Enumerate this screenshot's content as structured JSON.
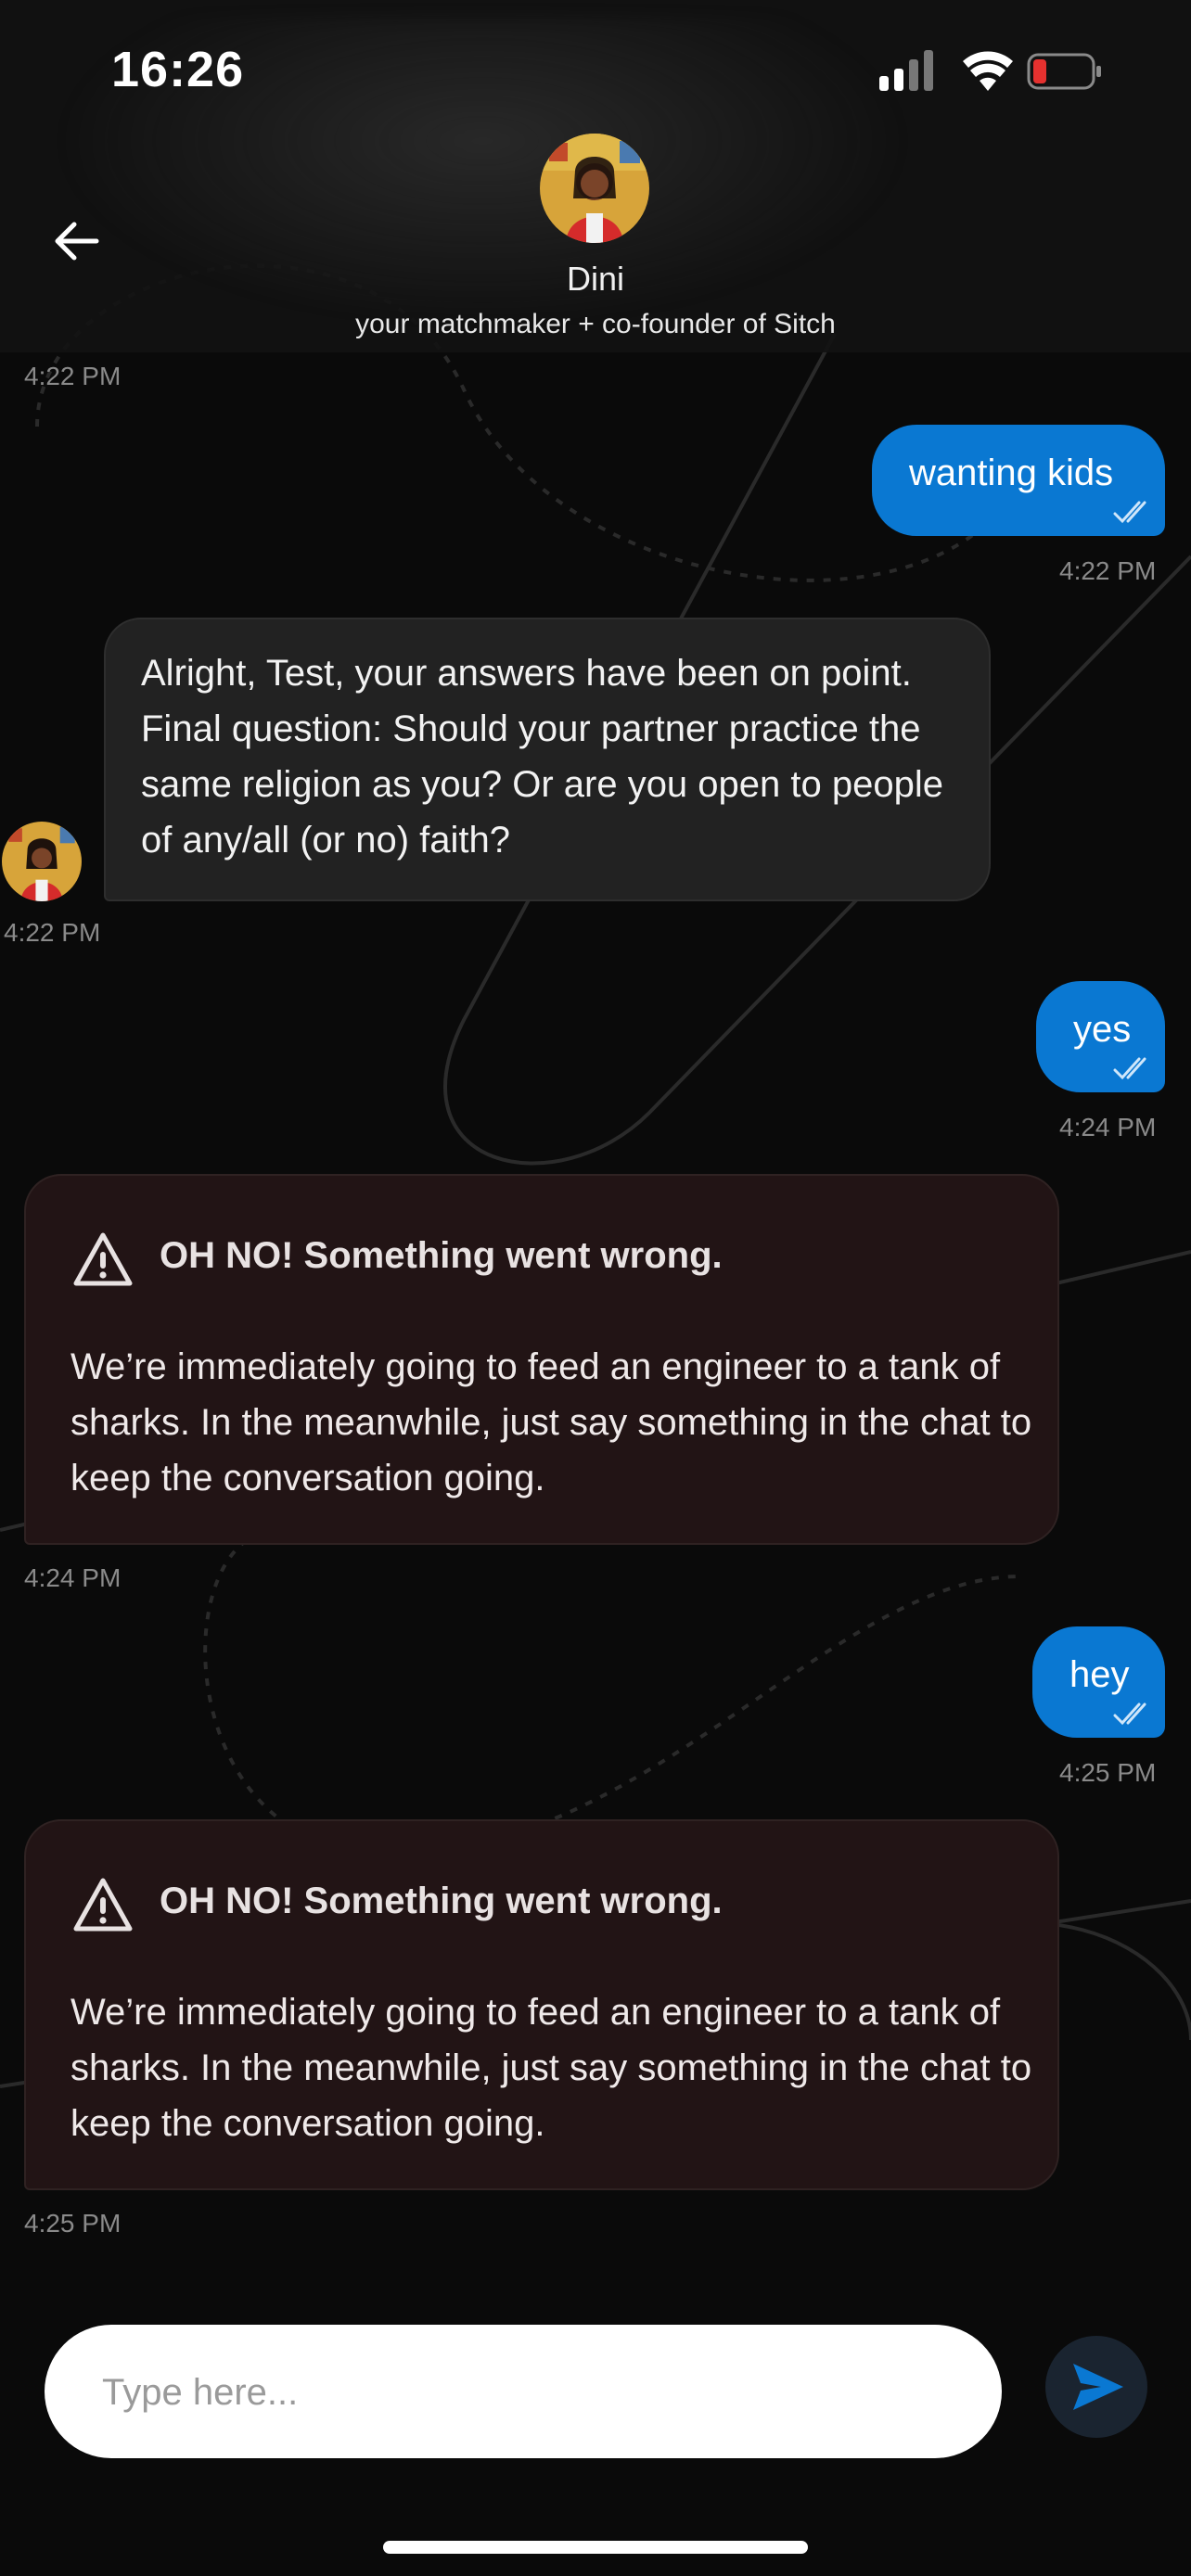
{
  "status_bar": {
    "time": "16:26"
  },
  "header": {
    "contact_name": "Dini",
    "contact_subtitle": "your matchmaker + co-founder of Sitch",
    "top_timestamp": "4:22 PM"
  },
  "messages": [
    {
      "type": "outgoing",
      "text": "wanting kids",
      "time": "4:22 PM"
    },
    {
      "type": "incoming",
      "text": "Alright, Test, your answers have been on point. Final question: Should your partner practice the same religion as you? Or are you open to people of any/all (or no) faith?",
      "time": "4:22 PM"
    },
    {
      "type": "outgoing",
      "text": "yes",
      "time": "4:24 PM"
    },
    {
      "type": "error",
      "title": "OH NO! Something went wrong.",
      "body": "We’re immediately going to feed an engineer to a tank of sharks. In the meanwhile, just say something in the chat to keep the conversation going.",
      "time": "4:24 PM"
    },
    {
      "type": "outgoing",
      "text": "hey",
      "time": "4:25 PM"
    },
    {
      "type": "error",
      "title": "OH NO! Something went wrong.",
      "body": "We’re immediately going to feed an engineer to a tank of sharks. In the meanwhile, just say something in the chat to keep the conversation going.",
      "time": "4:25 PM"
    }
  ],
  "composer": {
    "placeholder": "Type here..."
  },
  "colors": {
    "accent": "#0a78d2",
    "background": "#0a0a0a",
    "error_card": "#221415",
    "incoming_bubble": "#222222"
  },
  "icons": [
    "back-arrow-icon",
    "send-icon",
    "warning-triangle-icon",
    "read-receipt-icon",
    "signal-icon",
    "wifi-icon",
    "battery-icon"
  ]
}
